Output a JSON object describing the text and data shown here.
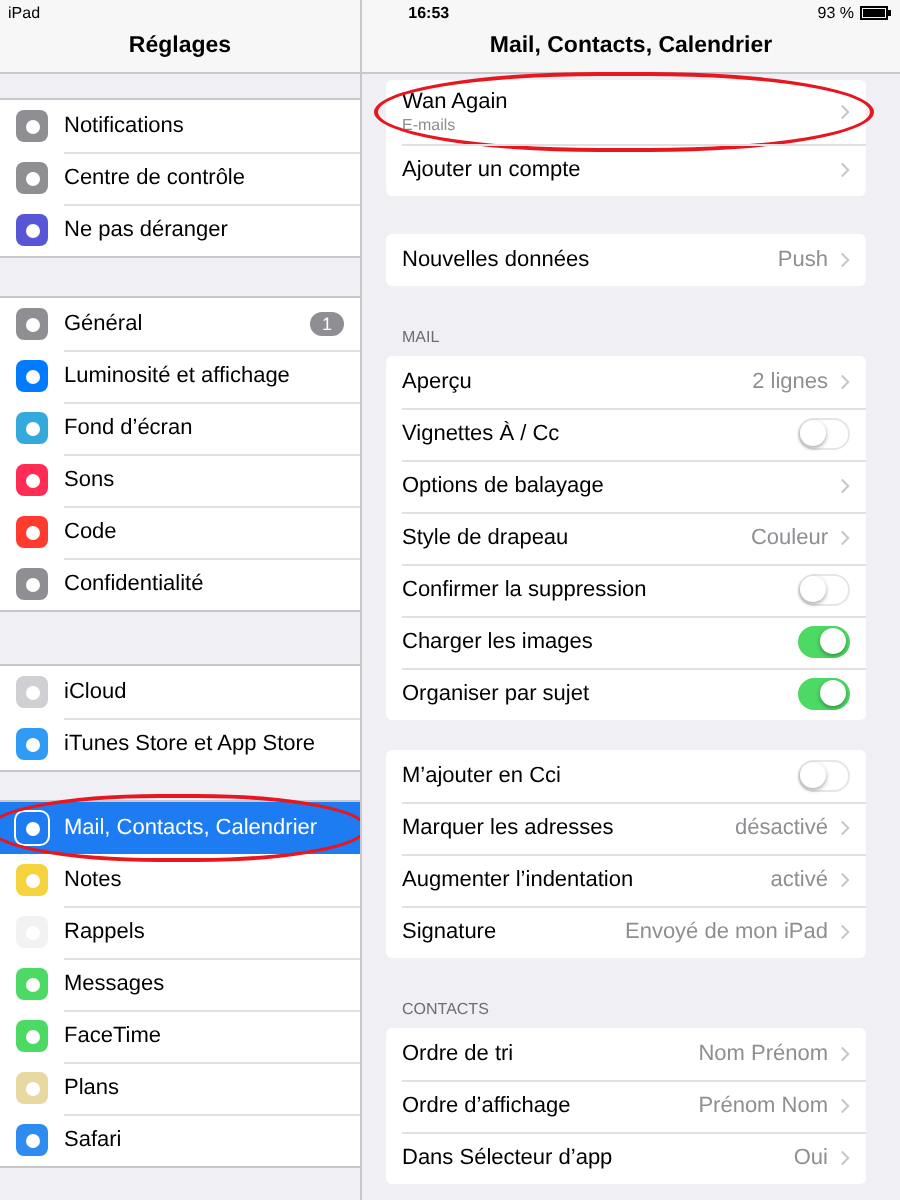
{
  "status_bar": {
    "device": "iPad",
    "time": "16:53",
    "battery": "93 %"
  },
  "sidebar": {
    "title": "Réglages",
    "groups": [
      {
        "items": [
          {
            "label": "Notifications",
            "color": "#8e8e93",
            "selected": false,
            "highlighted": false
          },
          {
            "label": "Centre de contrôle",
            "color": "#8e8e93",
            "selected": false,
            "highlighted": false
          },
          {
            "label": "Ne pas déranger",
            "color": "#5856d6",
            "selected": false,
            "highlighted": false
          }
        ]
      },
      {
        "items": [
          {
            "label": "Général",
            "color": "#8e8e93",
            "badge": "1",
            "selected": false,
            "highlighted": false
          },
          {
            "label": "Luminosité et affichage",
            "color": "#007aff",
            "selected": false,
            "highlighted": false
          },
          {
            "label": "Fond d’écran",
            "color": "#34aadc",
            "selected": false,
            "highlighted": false
          },
          {
            "label": "Sons",
            "color": "#ff2d55",
            "selected": false,
            "highlighted": false
          },
          {
            "label": "Code",
            "color": "#ff3b30",
            "selected": false,
            "highlighted": false
          },
          {
            "label": "Confidentialité",
            "color": "#8e8e93",
            "selected": false,
            "highlighted": false
          }
        ]
      },
      {
        "items": [
          {
            "label": "iCloud",
            "color": "#d0d0d4",
            "selected": false,
            "highlighted": false
          },
          {
            "label": "iTunes Store et App Store",
            "color": "#2f9bf5",
            "selected": false,
            "highlighted": false
          }
        ]
      },
      {
        "items": [
          {
            "label": "Mail, Contacts, Calendrier",
            "color": "#1e7cf2",
            "selected": true,
            "highlighted": true
          },
          {
            "label": "Notes",
            "color": "#f5d33d",
            "selected": false,
            "highlighted": false
          },
          {
            "label": "Rappels",
            "color": "#f2f2f2",
            "selected": false,
            "highlighted": false
          },
          {
            "label": "Messages",
            "color": "#4cd964",
            "selected": false,
            "highlighted": false
          },
          {
            "label": "FaceTime",
            "color": "#4cd964",
            "selected": false,
            "highlighted": false
          },
          {
            "label": "Plans",
            "color": "#e8d9a0",
            "selected": false,
            "highlighted": false
          },
          {
            "label": "Safari",
            "color": "#2e8cf0",
            "selected": false,
            "highlighted": false
          }
        ]
      }
    ]
  },
  "detail": {
    "title": "Mail, Contacts, Calendrier",
    "sections": [
      {
        "rows": [
          {
            "kind": "account",
            "label": "Wan Again",
            "subtitle": "E-mails",
            "highlighted": true
          },
          {
            "kind": "link",
            "label": "Ajouter un compte",
            "highlighted": false
          }
        ]
      },
      {
        "rows": [
          {
            "kind": "link",
            "label": "Nouvelles données",
            "value": "Push",
            "highlighted": false
          }
        ]
      },
      {
        "header": "MAIL",
        "rows": [
          {
            "kind": "link",
            "label": "Aperçu",
            "value": "2 lignes",
            "highlighted": false
          },
          {
            "kind": "switch",
            "label": "Vignettes À / Cc",
            "on": false,
            "highlighted": false
          },
          {
            "kind": "link",
            "label": "Options de balayage",
            "highlighted": false
          },
          {
            "kind": "link",
            "label": "Style de drapeau",
            "value": "Couleur",
            "highlighted": false
          },
          {
            "kind": "switch",
            "label": "Confirmer la suppression",
            "on": false,
            "highlighted": false
          },
          {
            "kind": "switch",
            "label": "Charger les images",
            "on": true,
            "highlighted": false
          },
          {
            "kind": "switch",
            "label": "Organiser par sujet",
            "on": true,
            "highlighted": false
          }
        ]
      },
      {
        "rows": [
          {
            "kind": "switch",
            "label": "M’ajouter en Cci",
            "on": false,
            "highlighted": false
          },
          {
            "kind": "link",
            "label": "Marquer les adresses",
            "value": "désactivé",
            "highlighted": false
          },
          {
            "kind": "link",
            "label": "Augmenter l’indentation",
            "value": "activé",
            "highlighted": false
          },
          {
            "kind": "link",
            "label": "Signature",
            "value": "Envoyé de mon iPad",
            "highlighted": false
          }
        ]
      },
      {
        "header": "CONTACTS",
        "rows": [
          {
            "kind": "link",
            "label": "Ordre de tri",
            "value": "Nom Prénom",
            "highlighted": false
          },
          {
            "kind": "link",
            "label": "Ordre d’affichage",
            "value": "Prénom Nom",
            "highlighted": false
          },
          {
            "kind": "link",
            "label": "Dans Sélecteur d’app",
            "value": "Oui",
            "highlighted": false
          }
        ]
      }
    ]
  }
}
